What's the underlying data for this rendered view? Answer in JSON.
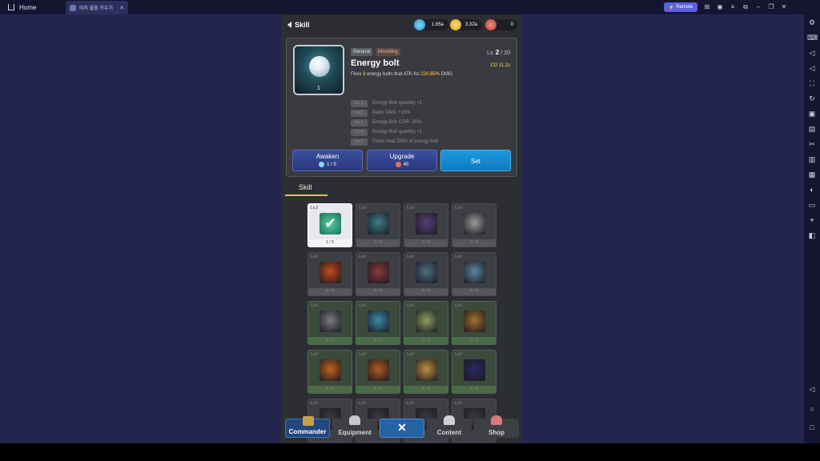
{
  "emulator": {
    "home_tab": "Home",
    "game_tab": "미지 울음 키우기",
    "remote_label": "Remote"
  },
  "header": {
    "title": "Skill",
    "gems": "1.65a",
    "gold": "3.32a",
    "tickets": "0"
  },
  "skill": {
    "tag_general": "General",
    "tag_mounting": "Mounting",
    "name": "Energy bolt",
    "desc_pre": "Fires ",
    "desc_count": "3",
    "desc_mid": " energy bolts that ATK for ",
    "desc_pct": "220.65%",
    "desc_post": " DMG.",
    "level_prefix": "Lv.",
    "level": "2",
    "level_max": "/ 20",
    "cd": "CD 11.2s",
    "icon_count": "1",
    "perks": [
      {
        "label": "no.1",
        "text": "Energy Bolt quantity +1"
      },
      {
        "label": "no.2",
        "text": "Basic DMG +15%"
      },
      {
        "label": "no.3",
        "text": "Energy Bolt CDR -25%"
      },
      {
        "label": "no.4",
        "text": "Energy Bolt quantity +1"
      },
      {
        "label": "no.5",
        "text": "Twice total DMG of energy bolt"
      }
    ]
  },
  "actions": {
    "awaken_label": "Awaken",
    "awaken_value": "1 / 5",
    "upgrade_label": "Upgrade",
    "upgrade_value": "40",
    "set_label": "Set"
  },
  "section_title": "Skill",
  "grid": [
    {
      "lvl": "Lv.2",
      "prog": "1 / 5",
      "color": "#2fa88a",
      "style": "active"
    },
    {
      "lvl": "Lv.0",
      "prog": "0 / 5",
      "color": "#3f7d8a",
      "style": "gray"
    },
    {
      "lvl": "Lv.0",
      "prog": "0 / 5",
      "color": "#5a3f7a",
      "style": "gray"
    },
    {
      "lvl": "Lv.0",
      "prog": "0 / 5",
      "color": "#9a9a9a",
      "style": "gray"
    },
    {
      "lvl": "Lv.0",
      "prog": "0 / 5",
      "color": "#c44a1e",
      "style": "gray"
    },
    {
      "lvl": "Lv.0",
      "prog": "0 / 5",
      "color": "#8a3a3a",
      "style": "gray"
    },
    {
      "lvl": "Lv.0",
      "prog": "0 / 5",
      "color": "#4d6f80",
      "style": "gray"
    },
    {
      "lvl": "Lv.0",
      "prog": "0 / 5",
      "color": "#5c86a0",
      "style": "gray"
    },
    {
      "lvl": "Lv.0",
      "prog": "0 / 5",
      "color": "#7a7a82",
      "style": "green"
    },
    {
      "lvl": "Lv.0",
      "prog": "0 / 5",
      "color": "#3c8aa6",
      "style": "green"
    },
    {
      "lvl": "Lv.0",
      "prog": "0 / 5",
      "color": "#8aa060",
      "style": "green"
    },
    {
      "lvl": "Lv.0",
      "prog": "0 / 5",
      "color": "#a0702c",
      "style": "green"
    },
    {
      "lvl": "Lv.0",
      "prog": "0 / 5",
      "color": "#c0621e",
      "style": "green"
    },
    {
      "lvl": "Lv.0",
      "prog": "0 / 5",
      "color": "#b05a20",
      "style": "green"
    },
    {
      "lvl": "Lv.0",
      "prog": "0 / 5",
      "color": "#c09040",
      "style": "green"
    },
    {
      "lvl": "Lv.0",
      "prog": "0 / 5",
      "color": "#2a2a60",
      "style": "green"
    },
    {
      "lvl": "Lv.0",
      "prog": "",
      "color": "#3a3b40",
      "style": "gray"
    },
    {
      "lvl": "Lv.0",
      "prog": "",
      "color": "#3a3b40",
      "style": "gray"
    },
    {
      "lvl": "Lv.0",
      "prog": "",
      "color": "#3a3b40",
      "style": "gray"
    },
    {
      "lvl": "Lv.0",
      "prog": "",
      "color": "#3a3b40",
      "style": "gray"
    }
  ],
  "nav": {
    "commander": "Commander",
    "equipment": "Equipment",
    "close": "✕",
    "content": "Content",
    "shop": "Shop"
  }
}
